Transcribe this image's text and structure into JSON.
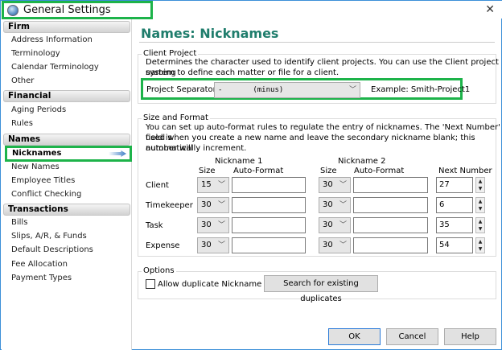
{
  "window": {
    "title": "General Settings",
    "close": "✕"
  },
  "sidebar": {
    "sections": [
      {
        "label": "Firm",
        "items": [
          "Address Information",
          "Terminology",
          "Calendar Terminology",
          "Other"
        ]
      },
      {
        "label": "Financial",
        "items": [
          "Aging Periods",
          "Rules"
        ]
      },
      {
        "label": "Names",
        "items": [
          "Nicknames",
          "New Names",
          "Employee Titles",
          "Conflict Checking"
        ]
      },
      {
        "label": "Transactions",
        "items": [
          "Bills",
          "Slips, A/R, & Funds",
          "Default Descriptions",
          "Fee Allocation",
          "Payment Types"
        ]
      }
    ],
    "selected": "Nicknames"
  },
  "main": {
    "heading": "Names: Nicknames",
    "client_project": {
      "title": "Client Project",
      "desc1": "Determines the character used to identify client projects. You can use the Client project naming",
      "desc2": "system to define each matter or file for a client.",
      "separator_label": "Project Separator",
      "separator_value": "-       (minus)",
      "example": "Example: Smith-Project1"
    },
    "size_format": {
      "title": "Size and Format",
      "desc1": "You can set up auto-format rules to regulate the entry of nicknames. The 'Next Number' field is",
      "desc2": "used when you create a new name and leave the secondary nickname blank; this number will",
      "desc3": "automatically increment.",
      "nick1": "Nickname 1",
      "nick2": "Nickname 2",
      "size": "Size",
      "auto_format": "Auto-Format",
      "next_number": "Next Number",
      "rows": [
        {
          "label": "Client",
          "size1": "15",
          "fmt1": "",
          "size2": "30",
          "fmt2": "",
          "next": "27"
        },
        {
          "label": "Timekeeper",
          "size1": "30",
          "fmt1": "",
          "size2": "30",
          "fmt2": "",
          "next": "6"
        },
        {
          "label": "Task",
          "size1": "30",
          "fmt1": "",
          "size2": "30",
          "fmt2": "",
          "next": "35"
        },
        {
          "label": "Expense",
          "size1": "30",
          "fmt1": "",
          "size2": "30",
          "fmt2": "",
          "next": "54"
        }
      ]
    },
    "options": {
      "title": "Options",
      "allow_dup": "Allow duplicate Nickname 2",
      "allow_dup_checked": false,
      "search_button": "Search for existing duplicates"
    }
  },
  "footer": {
    "ok": "OK",
    "cancel": "Cancel",
    "help": "Help"
  }
}
